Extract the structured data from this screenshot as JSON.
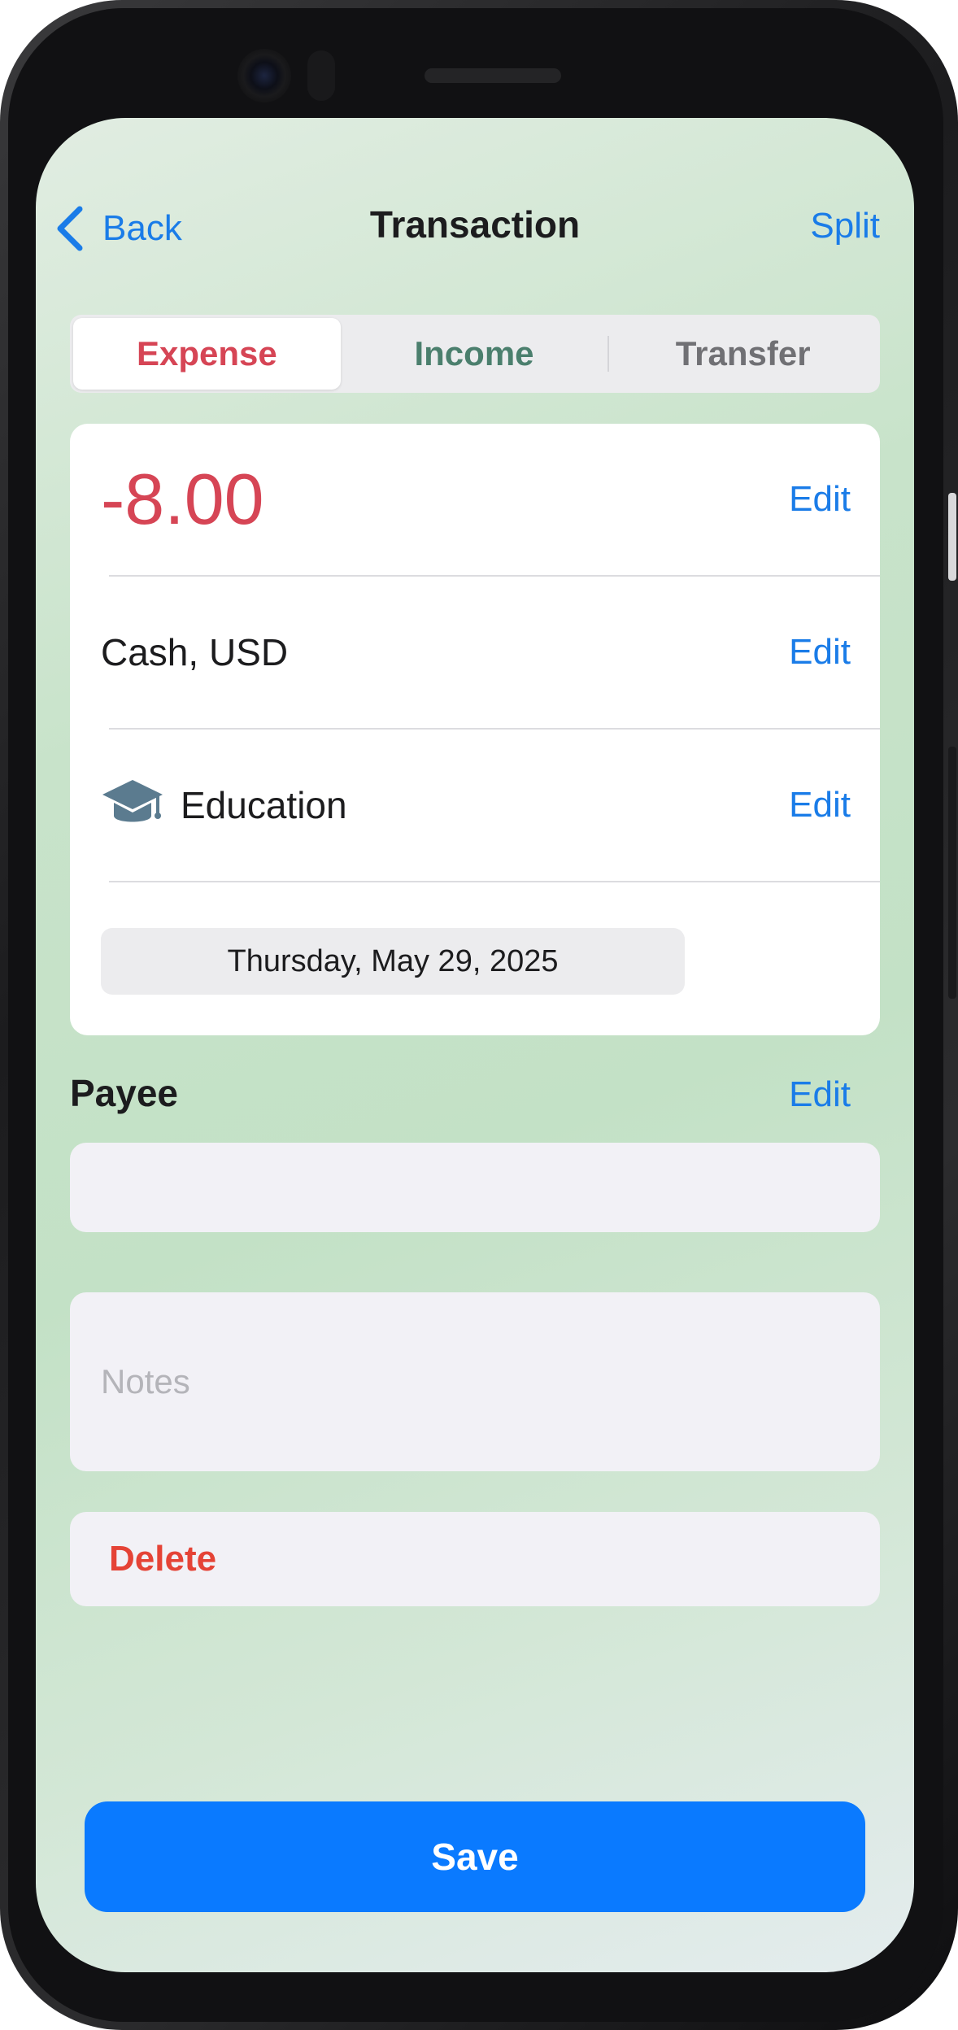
{
  "nav": {
    "back_label": "Back",
    "title": "Transaction",
    "split_label": "Split"
  },
  "type_selector": {
    "options": [
      "Expense",
      "Income",
      "Transfer"
    ],
    "selected": "Expense"
  },
  "transaction": {
    "amount": "-8.00",
    "account": "Cash, USD",
    "category": "Education",
    "category_icon": "graduation-cap-icon",
    "date": "Thursday, May 29, 2025",
    "edit_label": "Edit"
  },
  "payee": {
    "label": "Payee",
    "edit_label": "Edit",
    "value": ""
  },
  "notes": {
    "placeholder": "Notes",
    "value": ""
  },
  "actions": {
    "delete_label": "Delete",
    "save_label": "Save"
  },
  "colors": {
    "accent_blue": "#1a7ce8",
    "expense_red": "#d64555",
    "income_green": "#4b7f6d",
    "delete_red": "#e54336",
    "save_blue": "#0a7aff"
  }
}
